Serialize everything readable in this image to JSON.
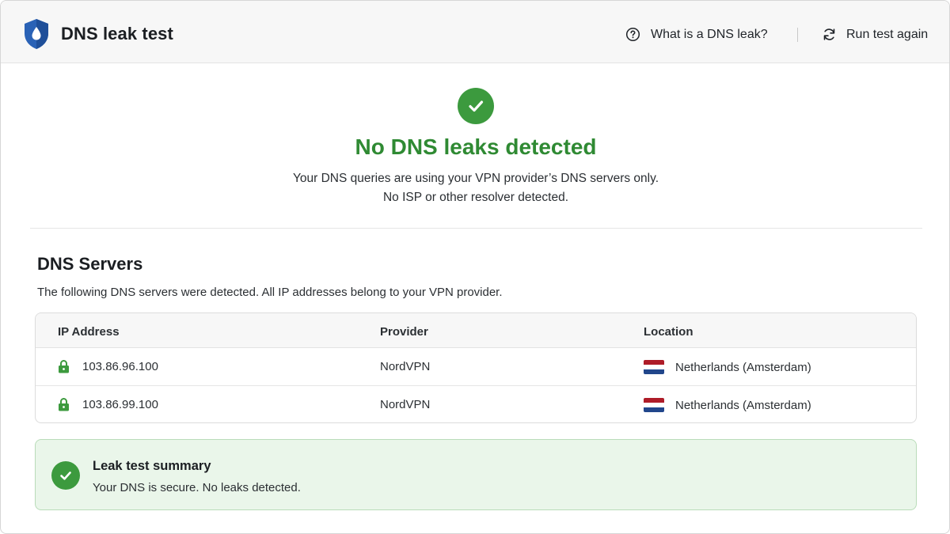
{
  "header": {
    "title": "DNS leak test",
    "help_label": "What is a DNS leak?",
    "rerun_label": "Run test again"
  },
  "result": {
    "title": "No DNS leaks detected",
    "line1": "Your DNS queries are using your VPN provider’s DNS servers only.",
    "line2": "No ISP or other resolver detected.",
    "status_color": "#3c9a3e"
  },
  "servers": {
    "title": "DNS Servers",
    "description": "The following DNS servers were detected. All IP addresses belong to your VPN provider.",
    "columns": [
      "IP Address",
      "Provider",
      "Location"
    ],
    "rows": [
      {
        "ip": "103.86.96.100",
        "provider": "NordVPN",
        "location": "Netherlands (Amsterdam)",
        "icon": "lock-icon",
        "flag": "netherlands-flag-icon"
      },
      {
        "ip": "103.86.99.100",
        "provider": "NordVPN",
        "location": "Netherlands (Amsterdam)",
        "icon": "lock-icon",
        "flag": "netherlands-flag-icon"
      }
    ]
  },
  "summary": {
    "title": "Leak test summary",
    "text": "Your DNS is secure. No leaks detected."
  },
  "colors": {
    "brand_shield": "#2a62b6",
    "success_green": "#3c9a3e",
    "success_text": "#2f8a33",
    "summary_bg": "#eaf6ea"
  }
}
